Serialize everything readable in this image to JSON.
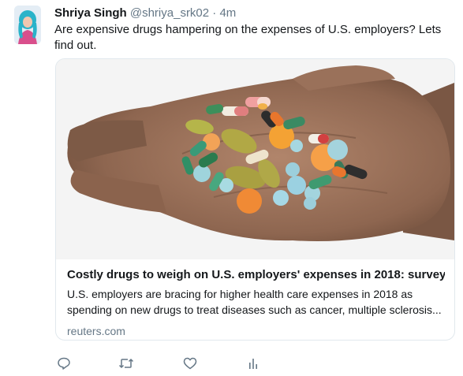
{
  "tweet": {
    "author_name": "Shriya Singh",
    "handle": "@shriya_srk02",
    "separator": "·",
    "time": "4m",
    "text": "Are expensive drugs hampering on the expenses of U.S. employers? Lets find out."
  },
  "card": {
    "image_icon": "hand-holding-pills-photo",
    "title": "Costly drugs to weigh on U.S. employers' expenses in 2018: survey",
    "description": "U.S. employers are bracing for higher health care expenses in 2018 as spending on new drugs to treat diseases such as cancer, multiple sclerosis...",
    "domain": "reuters.com"
  },
  "actions": {
    "icons": [
      "reply-icon",
      "retweet-icon",
      "like-icon",
      "analytics-icon"
    ]
  },
  "colors": {
    "secondary_text": "#657786",
    "border": "#e1e8ed"
  }
}
